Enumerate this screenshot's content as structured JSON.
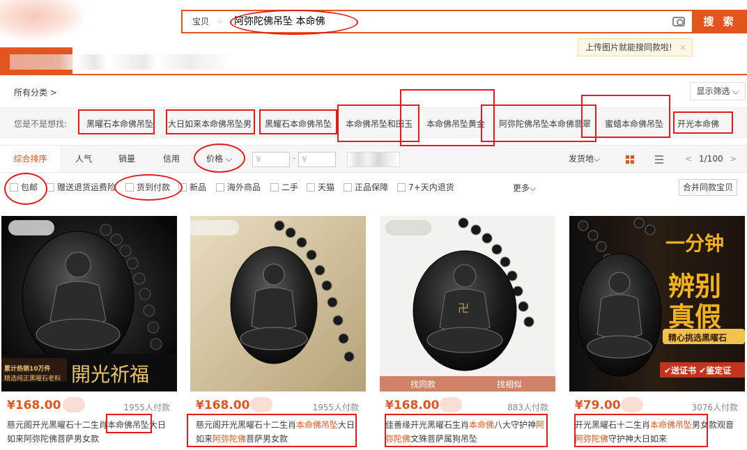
{
  "search": {
    "scope": "宝贝",
    "query": "阿弥陀佛吊坠 本命佛",
    "button": "搜 索",
    "tip": "上传图片就能搜同款啦!",
    "tip_close": "×"
  },
  "category": {
    "all": "所有分类 >",
    "filter": "显示筛选 ⌵"
  },
  "suggestions": {
    "label": "您是不是想找:",
    "items": [
      "黑曜石本命佛吊坠",
      "大日如来本命佛吊坠男",
      "黑耀石本命佛吊坠",
      "本命佛吊坠和田玉",
      "本命佛吊坠黄金",
      "阿弥陀佛吊坠本命佛翡翠",
      "蜜蜡本命佛吊坠",
      "开光本命佛"
    ]
  },
  "sort": {
    "items": [
      "综合排序",
      "人气",
      "销量",
      "信用",
      "价格 ⌵"
    ],
    "price_from": "¥",
    "price_to": "¥",
    "location": "发货地⌵",
    "page": "1/100",
    "prev": "<",
    "next": ">"
  },
  "checkboxes": [
    "包邮",
    "赠送退货运费险",
    "货到付款",
    "新品",
    "海外商品",
    "二手",
    "天猫",
    "正品保障",
    "7+天内退货"
  ],
  "more": "更多⌵",
  "merge": "合并同款宝贝",
  "products": [
    {
      "price": "¥168.00",
      "sales": "1955人付款",
      "title_pre": "慈元阁开光黑曜石十二生肖",
      "hl1": "本命佛吊坠",
      "title_mid": "大日如来阿弥陀佛菩萨男女款",
      "hl2": "",
      "title_post": "",
      "banner": "開光祈福",
      "banner_sub1": "累计热销10万件",
      "banner_sub2": "精选纯正黑曜石老料"
    },
    {
      "price": "¥168.00",
      "sales": "1955人付款",
      "title_pre": "慈元阁开光黑曜石十二生肖",
      "hl1": "本命佛吊坠",
      "title_mid": "大日如来",
      "hl2": "阿弥陀佛",
      "title_post": "菩萨男女款"
    },
    {
      "price": "¥168.00",
      "sales": "883人付款",
      "title_pre": "佳善缘开光黑曜石生肖",
      "hl1": "本命佛",
      "title_mid": "八大守护神",
      "hl2": "阿弥陀佛",
      "title_post": "文殊菩萨属狗吊坠",
      "find_same": "找同款",
      "find_similar": "找相似"
    },
    {
      "price": "¥79.00",
      "sales": "3076人付款",
      "title_pre": "开光黑曜石十二生肖",
      "hl1": "本命佛吊坠",
      "title_mid": "男女款观音",
      "hl2": "阿弥陀佛",
      "title_post": "守护神大日如来",
      "ad1": "一分钟",
      "ad2": "辨别",
      "ad3": "真假",
      "ad4": "精心挑选黑曜石",
      "ad5": "✔送证书 ✔鉴定证"
    }
  ],
  "colors": {
    "accent": "#e4541e",
    "annotation": "#e21b1b"
  }
}
